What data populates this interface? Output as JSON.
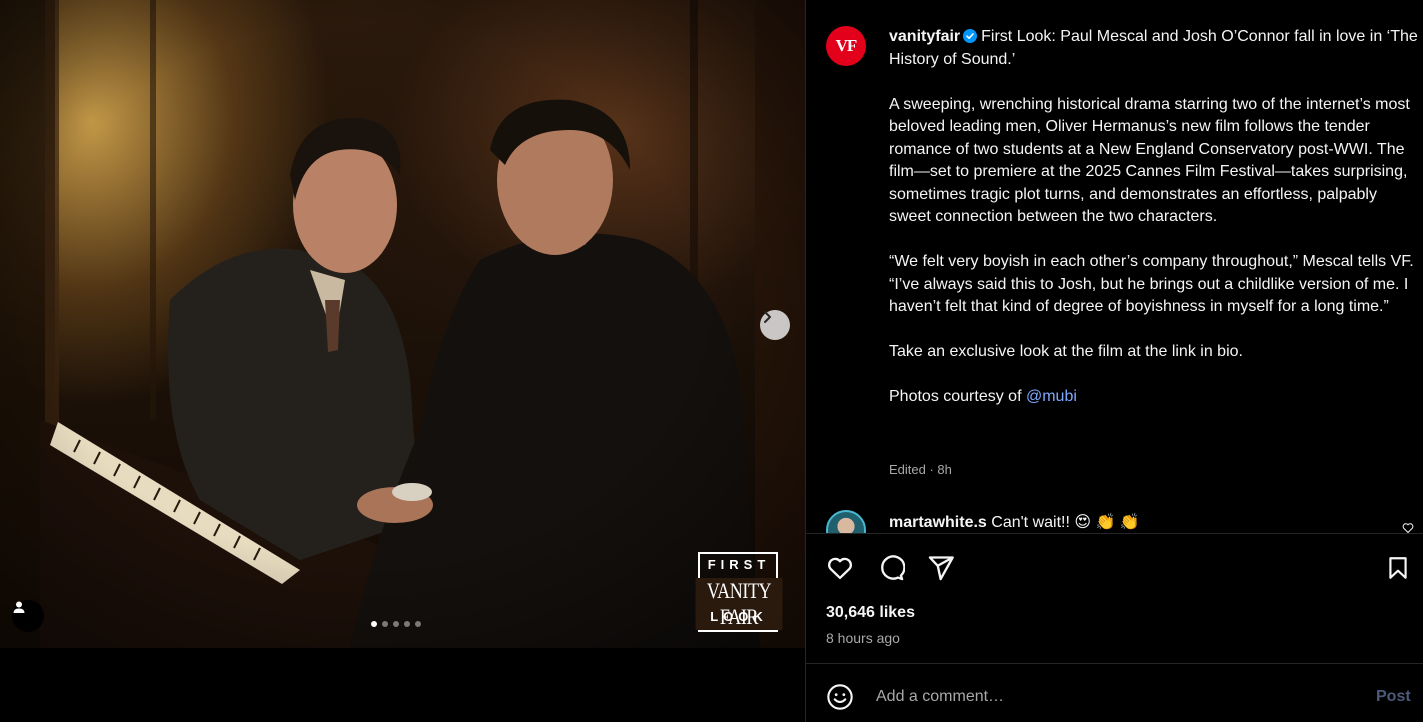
{
  "post": {
    "carousel_total": 5,
    "carousel_index": 1,
    "badge": {
      "top": "FIRST",
      "middle": "VANITY FAIR",
      "bottom": "LOOK"
    }
  },
  "author": {
    "username": "vanityfair",
    "avatar_text": "VF",
    "verified": true,
    "brand_color": "#e2001a"
  },
  "caption": {
    "headline": "First Look: Paul Mescal and Josh O’Connor fall in love in ‘The History of Sound.’",
    "paragraphs": [
      "A sweeping, wrenching historical drama starring two of the internet’s most beloved leading men, Oliver Hermanus’s new film follows the tender romance of two students at a New England Conservatory post-WWI. The film—set to premiere at the 2025 Cannes Film Festival—takes surprising, sometimes tragic plot turns, and demonstrates an effortless, palpably sweet connection between the two characters.",
      "“We felt very boyish in each other’s company throughout,” Mescal tells VF. “I’ve always said this to Josh, but he brings out a childlike version of me. I haven’t felt that kind of degree of boyishness in myself for a long time.”",
      "Take an exclusive look at the film at the link in bio."
    ],
    "credit_prefix": "Photos courtesy of ",
    "credit_mention": "@mubi",
    "edited_meta": "Edited · 8h"
  },
  "comments": [
    {
      "username": "martawhite.s",
      "text": "Can't wait!! 😍 👏 👏"
    }
  ],
  "stats": {
    "likes": "30,646 likes",
    "time": "8 hours ago"
  },
  "composer": {
    "placeholder": "Add a comment…",
    "post_label": "Post"
  },
  "icons": {
    "like": "heart-icon",
    "comment": "comment-bubble-icon",
    "share": "paper-plane-icon",
    "save": "bookmark-icon",
    "emoji": "smiley-icon",
    "next": "chevron-right-icon",
    "tags": "person-icon"
  },
  "colors": {
    "background": "#000000",
    "text": "#f5f5f5",
    "muted": "#a8a8a8",
    "link": "#7fa8ff",
    "verified": "#0095f6",
    "post_disabled": "#4c5a7a"
  }
}
